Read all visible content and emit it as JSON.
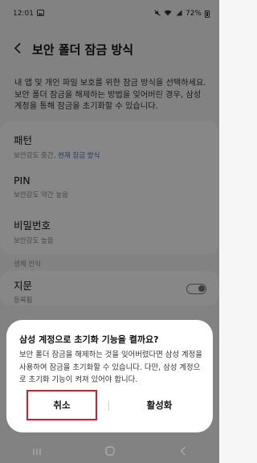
{
  "status_bar": {
    "time": "12:01",
    "battery": "72%",
    "left_icon": "gallery-notification-icon",
    "right_icons": [
      "mute-icon",
      "wifi-icon",
      "signal-icon",
      "battery-icon"
    ]
  },
  "header": {
    "back_icon": "arrow-left-icon",
    "title": "보안 폴더 잠금 방식"
  },
  "description": "내 앱 및 개인 파일 보호를 위한 잠금 방식을 선택하세요. 보안 폴더 잠금을 해제하는 방법을 잊어버린 경우, 삼성 계정을 통해 잠금을 초기화할 수 있습니다.",
  "lock_options": [
    {
      "title": "패턴",
      "strength": "보안강도 중간,",
      "current": "현재 잠금 방식"
    },
    {
      "title": "PIN",
      "strength": "보안강도 약간 높음",
      "current": ""
    },
    {
      "title": "비밀번호",
      "strength": "보안강도 높음",
      "current": ""
    }
  ],
  "biometrics": {
    "section_label": "생체 인식",
    "fingerprint_title": "지문",
    "fingerprint_sub": "등록됨",
    "toggle_state": "off"
  },
  "dialog": {
    "title": "삼성 계정으로 초기화 기능을 켤까요?",
    "body": "보안 폴더 잠금을 해제하는 것을 잊어버렸다면 삼성 계정을 사용하여 잠금을 초기화할 수 있습니다. 다만, 삼성 계정으로 초기화 기능이 켜져 있어야 합니다.",
    "cancel_label": "취소",
    "activate_label": "활성화",
    "highlight_color": "#e0182a"
  },
  "nav_bar": {
    "recent_icon": "recent-apps-icon",
    "home_icon": "home-icon",
    "back_icon": "back-icon"
  }
}
